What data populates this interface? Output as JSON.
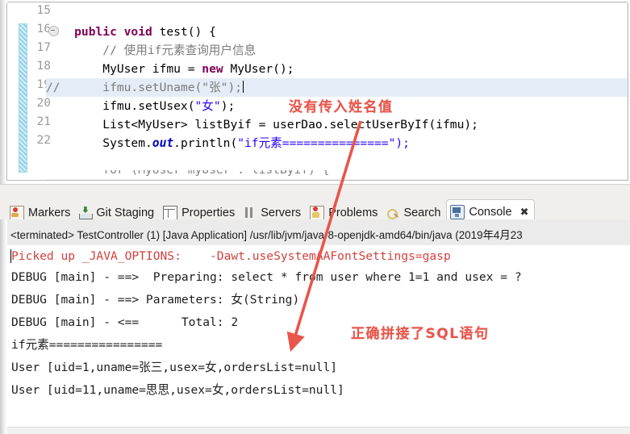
{
  "editor": {
    "lines": [
      {
        "num": "15",
        "segments": []
      },
      {
        "num": "16",
        "folded": true,
        "text": "    public void test() {"
      },
      {
        "num": "17",
        "text": "        // 使用if元素查询用户信息"
      },
      {
        "num": "18",
        "text": "        MyUser ifmu = new MyUser();"
      },
      {
        "num": "19",
        "text": "//      ifmu.setUname(\"张\");",
        "highlighted": true
      },
      {
        "num": "20",
        "text": "        ifmu.setUsex(\"女\");"
      },
      {
        "num": "21",
        "text": "        List<MyUser> listByif = userDao.selectUserByIf(ifmu);"
      },
      {
        "num": "22",
        "text": "        System.out.println(\"if元素===============\");"
      }
    ],
    "partial_next_line": "        for (MyUser myUser : listByif) {",
    "fold_icon": "collapse-fold-icon"
  },
  "tabs": [
    {
      "label": "Markers",
      "icon": "markers-icon",
      "active": false
    },
    {
      "label": "Git Staging",
      "icon": "git-staging-icon",
      "active": false
    },
    {
      "label": "Properties",
      "icon": "properties-icon",
      "active": false
    },
    {
      "label": "Servers",
      "icon": "servers-icon",
      "active": false
    },
    {
      "label": "Problems",
      "icon": "problems-icon",
      "active": false
    },
    {
      "label": "Search",
      "icon": "search-icon",
      "active": false
    },
    {
      "label": "Console",
      "icon": "console-icon",
      "active": true,
      "close": "✖"
    }
  ],
  "console": {
    "title": "<terminated> TestController (1) [Java Application] /usr/lib/jvm/java-8-openjdk-amd64/bin/java (2019年4月23",
    "lines": [
      {
        "text": "Picked up _JAVA_OPTIONS:    -Dawt.useSystemAAFontSettings=gasp",
        "error": true
      },
      {
        "text": "DEBUG [main] - ==>  Preparing: select * from user where 1=1 and usex = ?",
        "error": false
      },
      {
        "text": "DEBUG [main] - ==> Parameters: 女(String)",
        "error": false
      },
      {
        "text": "DEBUG [main] - <==      Total: 2",
        "error": false
      },
      {
        "text": "if元素================",
        "error": false
      },
      {
        "text": "User [uid=1,uname=张三,usex=女,ordersList=null]",
        "error": false
      },
      {
        "text": "User [uid=11,uname=思思,usex=女,ordersList=null]",
        "error": false
      }
    ]
  },
  "annotations": [
    {
      "text": "没有传入姓名值",
      "color": "#e8564c"
    },
    {
      "text": "正确拼接了SQL语句",
      "color": "#e8564c"
    }
  ],
  "colors": {
    "annotation_red": "#e8564c",
    "keyword_purple": "#7f0055",
    "string_blue": "#2a00ff",
    "comment_green": "#3f7f5f",
    "error_red": "#d2413f",
    "change_bar_blue": "#8fd0e8"
  }
}
